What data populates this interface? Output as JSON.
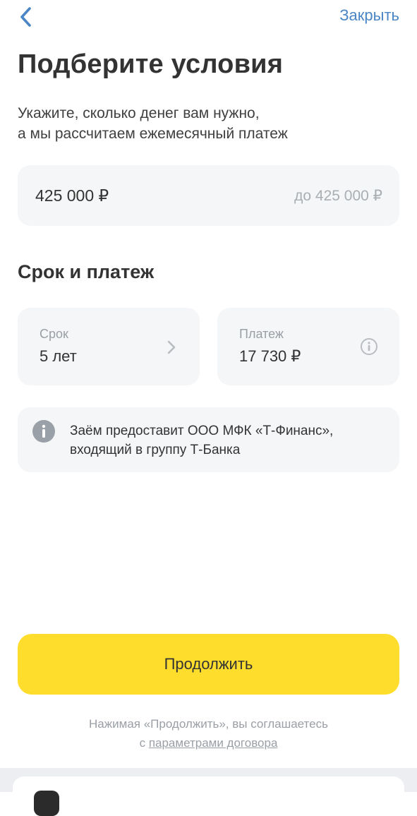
{
  "header": {
    "back_icon": "chevron-left-icon",
    "close_label": "Закрыть",
    "accent_color": "#4a86c5"
  },
  "page": {
    "title": "Подберите условия",
    "subtitle_lines": [
      "Укажите, сколько денег вам нужно,",
      "а мы рассчитаем ежемесячный платеж"
    ]
  },
  "amount": {
    "value": "425 000 ₽",
    "limit": "до 425 000 ₽"
  },
  "terms": {
    "section_title": "Срок и платеж",
    "term": {
      "label": "Срок",
      "value": "5 лет",
      "icon": "chevron-right-icon"
    },
    "payment": {
      "label": "Платеж",
      "value": "17 730 ₽",
      "icon": "info-icon"
    }
  },
  "notice": {
    "icon": "info-filled-icon",
    "lines": [
      "Заём предоставит ООО МФК «Т-Финанс»,",
      "входящий в группу Т-Банка"
    ]
  },
  "continue_button": {
    "label": "Продолжить",
    "color": "#ffdd2d"
  },
  "legal": {
    "line1": "Нажимая «Продолжить», вы соглашаетесь",
    "prefix": "с ",
    "link": "параметрами договора"
  }
}
